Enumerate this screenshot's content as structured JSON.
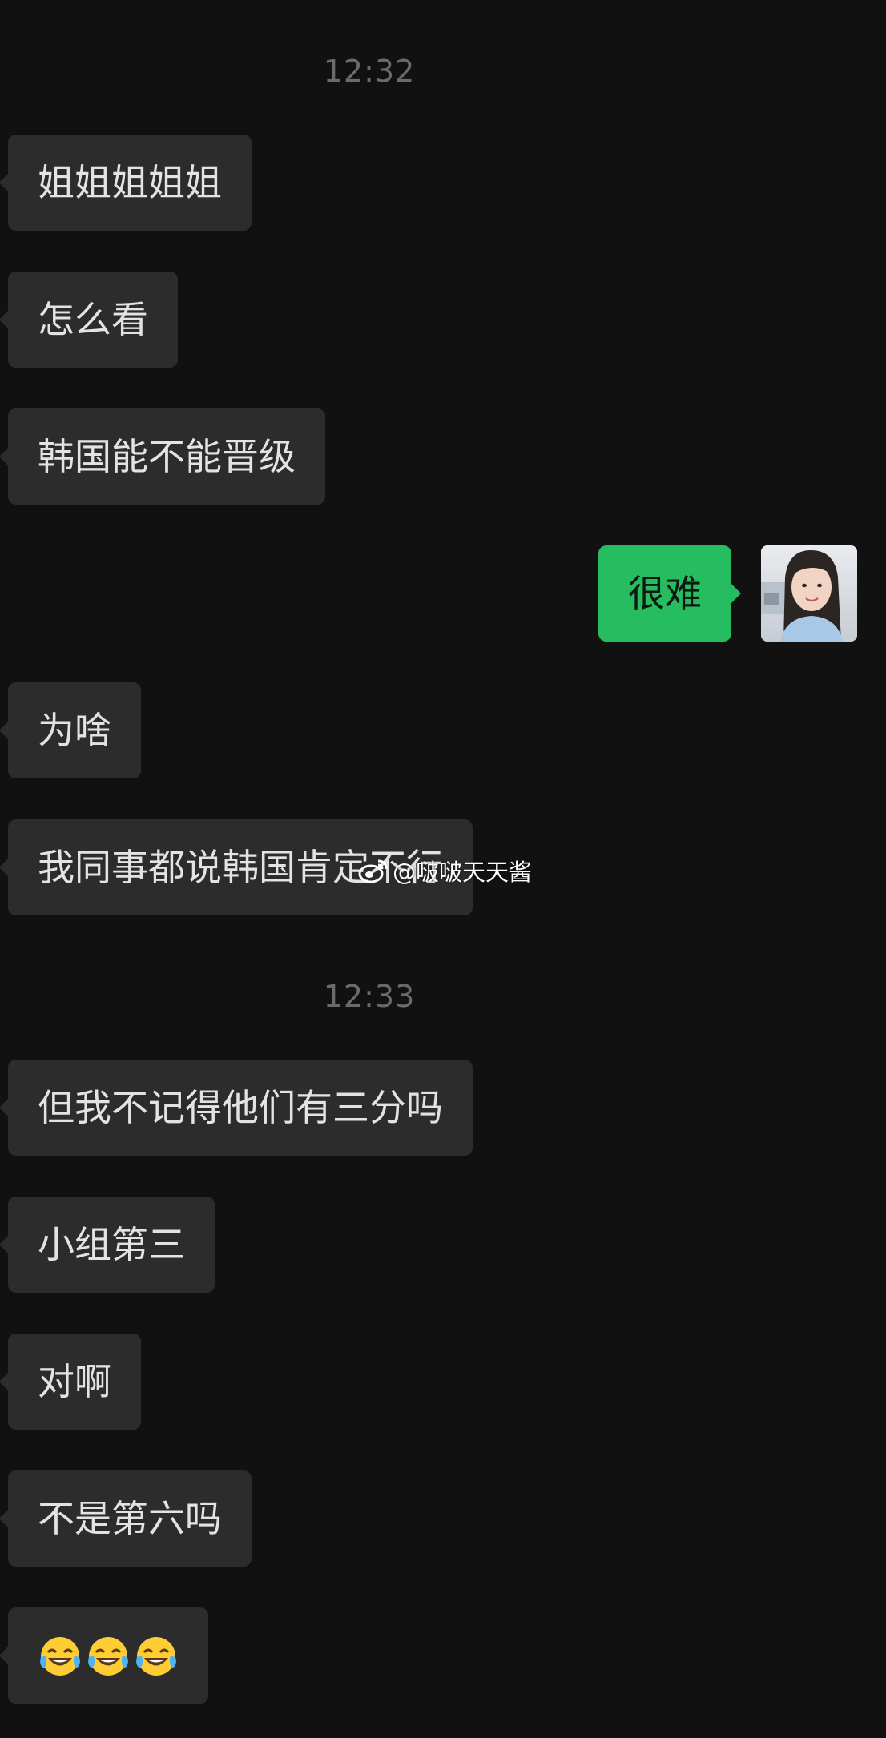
{
  "chat": {
    "timestamps": [
      "12:32",
      "12:33"
    ],
    "messages": [
      {
        "from": "other",
        "text": "姐姐姐姐姐"
      },
      {
        "from": "other",
        "text": "怎么看"
      },
      {
        "from": "other",
        "text": "韩国能不能晋级"
      },
      {
        "from": "me",
        "text": "很难"
      },
      {
        "from": "other",
        "text": "为啥"
      },
      {
        "from": "other",
        "text": "我同事都说韩国肯定不行"
      },
      {
        "from": "other",
        "text": "但我不记得他们有三分吗"
      },
      {
        "from": "other",
        "text": "小组第三"
      },
      {
        "from": "other",
        "text": "对啊"
      },
      {
        "from": "other",
        "text": "不是第六吗"
      },
      {
        "from": "other",
        "emoji": [
          "face-with-tears-of-joy",
          "face-with-tears-of-joy",
          "face-with-tears-of-joy"
        ]
      }
    ]
  },
  "watermark": {
    "text": "@啵啵天天酱",
    "icon": "weibo-icon"
  },
  "avatar": {
    "icon": "user-avatar"
  },
  "colors": {
    "background": "#111111",
    "incoming_bubble": "#2c2c2c",
    "outgoing_bubble": "#26bd60",
    "timestamp": "#6b6b6b"
  }
}
